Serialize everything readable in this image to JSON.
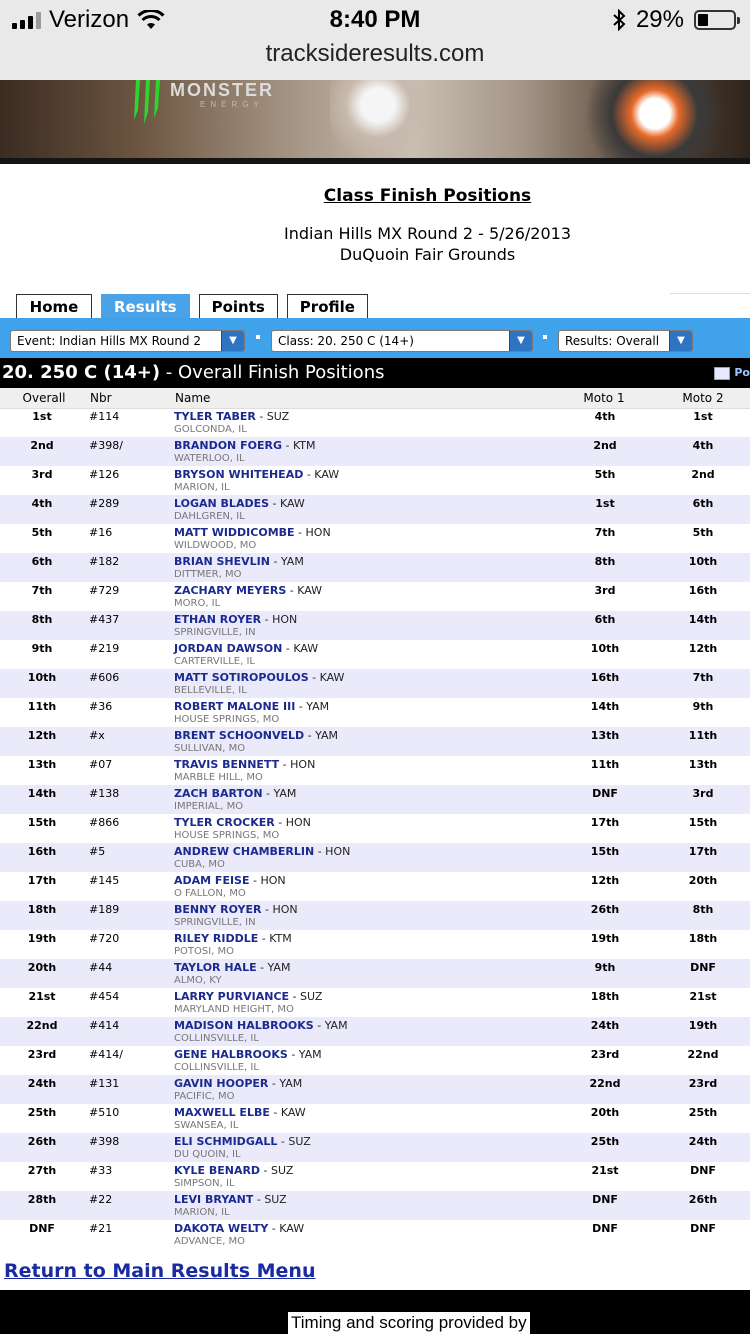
{
  "status_bar": {
    "carrier": "Verizon",
    "time": "8:40 PM",
    "battery": "29%",
    "url": "tracksideresults.com"
  },
  "banner": {
    "brand": "MONSTER",
    "brand_sub": "ENERGY"
  },
  "header": {
    "title": "Class Finish Positions",
    "event": "Indian Hills MX Round 2 - 5/26/2013",
    "venue": "DuQuoin Fair Grounds"
  },
  "tabs": [
    {
      "label": "Home",
      "active": false
    },
    {
      "label": "Results",
      "active": true
    },
    {
      "label": "Points",
      "active": false
    },
    {
      "label": "Profile",
      "active": false
    }
  ],
  "filters": {
    "event": "Event: Indian Hills MX Round 2",
    "class": "Class: 20. 250 C (14+)",
    "results": "Results: Overall"
  },
  "class_bar": {
    "class": "20. 250 C (14+)",
    "subtitle": " - Overall Finish Positions",
    "print": "Po"
  },
  "columns": {
    "overall": "Overall",
    "nbr": "Nbr",
    "name": "Name",
    "moto1": "Moto 1",
    "moto2": "Moto 2"
  },
  "results": [
    {
      "overall": "1st",
      "nbr": "#114",
      "rider": "TYLER TABER",
      "bike": " - SUZ",
      "hometown": "GOLCONDA, IL",
      "moto1": "4th",
      "moto2": "1st"
    },
    {
      "overall": "2nd",
      "nbr": "#398/",
      "rider": "BRANDON FOERG",
      "bike": " - KTM",
      "hometown": "WATERLOO, IL",
      "moto1": "2nd",
      "moto2": "4th"
    },
    {
      "overall": "3rd",
      "nbr": "#126",
      "rider": "BRYSON WHITEHEAD",
      "bike": " - KAW",
      "hometown": "MARION, IL",
      "moto1": "5th",
      "moto2": "2nd"
    },
    {
      "overall": "4th",
      "nbr": "#289",
      "rider": "LOGAN BLADES",
      "bike": " - KAW",
      "hometown": "DAHLGREN, IL",
      "moto1": "1st",
      "moto2": "6th"
    },
    {
      "overall": "5th",
      "nbr": "#16",
      "rider": "MATT WIDDICOMBE",
      "bike": " - HON",
      "hometown": "WILDWOOD, MO",
      "moto1": "7th",
      "moto2": "5th"
    },
    {
      "overall": "6th",
      "nbr": "#182",
      "rider": "BRIAN SHEVLIN",
      "bike": " - YAM",
      "hometown": "DITTMER, MO",
      "moto1": "8th",
      "moto2": "10th"
    },
    {
      "overall": "7th",
      "nbr": "#729",
      "rider": "ZACHARY MEYERS",
      "bike": " - KAW",
      "hometown": "MORO, IL",
      "moto1": "3rd",
      "moto2": "16th"
    },
    {
      "overall": "8th",
      "nbr": "#437",
      "rider": "ETHAN ROYER",
      "bike": " - HON",
      "hometown": "SPRINGVILLE, IN",
      "moto1": "6th",
      "moto2": "14th"
    },
    {
      "overall": "9th",
      "nbr": "#219",
      "rider": "JORDAN DAWSON",
      "bike": " - KAW",
      "hometown": "CARTERVILLE, IL",
      "moto1": "10th",
      "moto2": "12th"
    },
    {
      "overall": "10th",
      "nbr": "#606",
      "rider": "MATT SOTIROPOULOS",
      "bike": " - KAW",
      "hometown": "BELLEVILLE, IL",
      "moto1": "16th",
      "moto2": "7th"
    },
    {
      "overall": "11th",
      "nbr": "#36",
      "rider": "ROBERT MALONE III",
      "bike": " - YAM",
      "hometown": "HOUSE SPRINGS, MO",
      "moto1": "14th",
      "moto2": "9th"
    },
    {
      "overall": "12th",
      "nbr": "#x",
      "rider": "BRENT SCHOONVELD",
      "bike": " - YAM",
      "hometown": "SULLIVAN, MO",
      "moto1": "13th",
      "moto2": "11th"
    },
    {
      "overall": "13th",
      "nbr": "#07",
      "rider": "TRAVIS BENNETT",
      "bike": " - HON",
      "hometown": "MARBLE HILL, MO",
      "moto1": "11th",
      "moto2": "13th"
    },
    {
      "overall": "14th",
      "nbr": "#138",
      "rider": "ZACH BARTON",
      "bike": " - YAM",
      "hometown": "IMPERIAL, MO",
      "moto1": "DNF",
      "moto2": "3rd"
    },
    {
      "overall": "15th",
      "nbr": "#866",
      "rider": "TYLER CROCKER",
      "bike": " - HON",
      "hometown": "HOUSE SPRINGS, MO",
      "moto1": "17th",
      "moto2": "15th"
    },
    {
      "overall": "16th",
      "nbr": "#5",
      "rider": "ANDREW CHAMBERLIN",
      "bike": " - HON",
      "hometown": "CUBA, MO",
      "moto1": "15th",
      "moto2": "17th"
    },
    {
      "overall": "17th",
      "nbr": "#145",
      "rider": "ADAM FEISE",
      "bike": " - HON",
      "hometown": "O FALLON, MO",
      "moto1": "12th",
      "moto2": "20th"
    },
    {
      "overall": "18th",
      "nbr": "#189",
      "rider": "BENNY ROYER",
      "bike": " - HON",
      "hometown": "SPRINGVILLE, IN",
      "moto1": "26th",
      "moto2": "8th"
    },
    {
      "overall": "19th",
      "nbr": "#720",
      "rider": "RILEY RIDDLE",
      "bike": " - KTM",
      "hometown": "POTOSI, MO",
      "moto1": "19th",
      "moto2": "18th"
    },
    {
      "overall": "20th",
      "nbr": "#44",
      "rider": "TAYLOR HALE",
      "bike": " - YAM",
      "hometown": "ALMO, KY",
      "moto1": "9th",
      "moto2": "DNF"
    },
    {
      "overall": "21st",
      "nbr": "#454",
      "rider": "LARRY PURVIANCE",
      "bike": " - SUZ",
      "hometown": "MARYLAND HEIGHT, MO",
      "moto1": "18th",
      "moto2": "21st"
    },
    {
      "overall": "22nd",
      "nbr": "#414",
      "rider": "MADISON HALBROOKS",
      "bike": " - YAM",
      "hometown": "COLLINSVILLE, IL",
      "moto1": "24th",
      "moto2": "19th"
    },
    {
      "overall": "23rd",
      "nbr": "#414/",
      "rider": "GENE HALBROOKS",
      "bike": " - YAM",
      "hometown": "COLLINSVILLE, IL",
      "moto1": "23rd",
      "moto2": "22nd"
    },
    {
      "overall": "24th",
      "nbr": "#131",
      "rider": "GAVIN HOOPER",
      "bike": " - YAM",
      "hometown": "PACIFIC, MO",
      "moto1": "22nd",
      "moto2": "23rd"
    },
    {
      "overall": "25th",
      "nbr": "#510",
      "rider": "MAXWELL ELBE",
      "bike": " - KAW",
      "hometown": "SWANSEA, IL",
      "moto1": "20th",
      "moto2": "25th"
    },
    {
      "overall": "26th",
      "nbr": "#398",
      "rider": "ELI SCHMIDGALL",
      "bike": " - SUZ",
      "hometown": "DU QUOIN, IL",
      "moto1": "25th",
      "moto2": "24th"
    },
    {
      "overall": "27th",
      "nbr": "#33",
      "rider": "KYLE BENARD",
      "bike": " - SUZ",
      "hometown": "SIMPSON, IL",
      "moto1": "21st",
      "moto2": "DNF"
    },
    {
      "overall": "28th",
      "nbr": "#22",
      "rider": "LEVI BRYANT",
      "bike": " - SUZ",
      "hometown": "MARION, IL",
      "moto1": "DNF",
      "moto2": "26th"
    },
    {
      "overall": "DNF",
      "nbr": "#21",
      "rider": "DAKOTA WELTY",
      "bike": " - KAW",
      "hometown": "ADVANCE, MO",
      "moto1": "DNF",
      "moto2": "DNF"
    }
  ],
  "return_link": "Return to Main Results Menu",
  "footer": {
    "credit": "Timing and scoring provided by"
  },
  "colors": {
    "tab_active": "#4aa3e8",
    "filter_bar": "#3fa2ea",
    "rider_name": "#1b2a8f",
    "row_alt": "#eaeafb"
  }
}
